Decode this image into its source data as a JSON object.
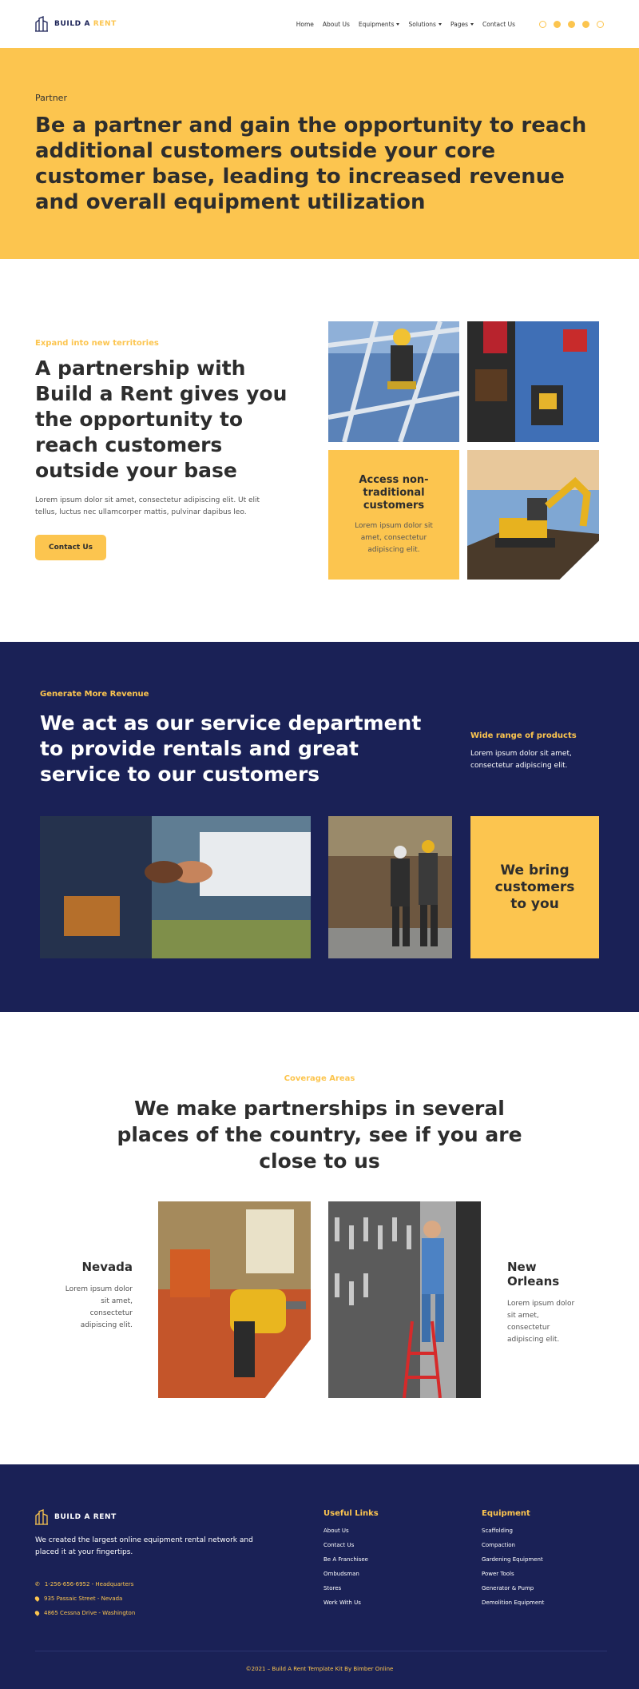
{
  "brand": {
    "part1": "BUILD A ",
    "part2": "RENT"
  },
  "nav": [
    {
      "label": "Home",
      "dropdown": false
    },
    {
      "label": "About Us",
      "dropdown": false
    },
    {
      "label": "Equipments",
      "dropdown": true
    },
    {
      "label": "Solutions",
      "dropdown": true
    },
    {
      "label": "Pages",
      "dropdown": true
    },
    {
      "label": "Contact Us",
      "dropdown": false
    }
  ],
  "socials": [
    "instagram-icon",
    "facebook-icon",
    "twitter-icon",
    "youtube-icon",
    "pinterest-icon"
  ],
  "hero": {
    "label": "Partner",
    "title": "Be a partner and gain the opportunity to reach additional customers outside your core customer base, leading to increased revenue and overall equipment utilization"
  },
  "partnership": {
    "eyebrow": "Expand into new territories",
    "title": "A partnership with Build a Rent gives you the opportunity to reach customers outside your base",
    "text": "Lorem ipsum dolor sit amet, consectetur adipiscing elit. Ut elit tellus, luctus nec ullamcorper mattis, pulvinar dapibus leo.",
    "button": "Contact Us",
    "card_title": "Access non-traditional customers",
    "card_text": "Lorem ipsum dolor sit amet, consectetur adipiscing elit."
  },
  "revenue": {
    "eyebrow": "Generate More Revenue",
    "title": "We act as our service department to provide rentals and great service to our customers",
    "side_title": "Wide range of products",
    "side_text": "Lorem ipsum dolor sit amet, consectetur adipiscing elit.",
    "card": "We bring customers to you"
  },
  "coverage": {
    "eyebrow": "Coverage Areas",
    "title": "We make partnerships in several places of the country, see if you are close to us",
    "cities": [
      {
        "name": "Nevada",
        "text": "Lorem ipsum dolor sit amet, consectetur adipiscing elit."
      },
      {
        "name": "New Orleans",
        "text": "Lorem ipsum dolor sit amet, consectetur adipiscing elit."
      }
    ]
  },
  "footer": {
    "brand": "BUILD A RENT",
    "about": "We created the largest online equipment rental network and placed it at your fingertips.",
    "contacts": [
      "1-256-656-6952 - Headquarters",
      "935 Passaic Street - Nevada",
      "4865 Cessna Drive - Washington"
    ],
    "useful_title": "Useful Links",
    "useful_links": [
      "About Us",
      "Contact Us",
      "Be A Franchisee",
      "Ombudsman",
      "Stores",
      "Work With Us"
    ],
    "equipment_title": "Equipment",
    "equipment_links": [
      "Scaffolding",
      "Compaction",
      "Gardening Equipment",
      "Power Tools",
      "Generator & Pump",
      "Demolition Equipment"
    ],
    "copyright": "©2021 – Build A Rent Template Kit By Bimber Online"
  },
  "colors": {
    "accent": "#fcc54f",
    "navy": "#1a2156",
    "text": "#2d2d2d"
  }
}
